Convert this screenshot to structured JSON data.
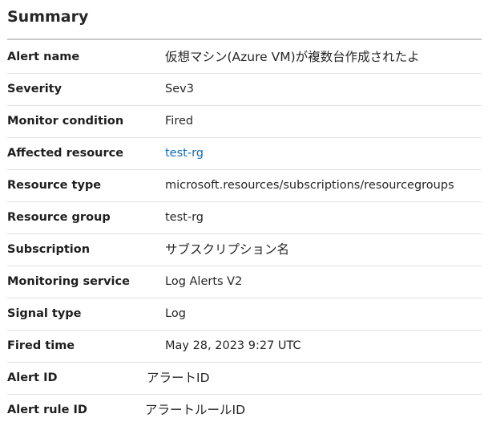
{
  "summary": {
    "title": "Summary",
    "rows": [
      {
        "label": "Alert name",
        "value": "仮想マシン(Azure VM)が複数台作成されたよ"
      },
      {
        "label": "Severity",
        "value": "Sev3"
      },
      {
        "label": "Monitor condition",
        "value": "Fired"
      },
      {
        "label": "Affected resource",
        "value": "test-rg"
      },
      {
        "label": "Resource type",
        "value": "microsoft.resources/subscriptions/resourcegroups"
      },
      {
        "label": "Resource group",
        "value": "test-rg"
      },
      {
        "label": "Subscription",
        "value": "サブスクリプション名"
      },
      {
        "label": "Monitoring service",
        "value": "Log Alerts V2"
      },
      {
        "label": "Signal type",
        "value": "Log"
      },
      {
        "label": "Fired time",
        "value": "May 28, 2023 9:27 UTC"
      },
      {
        "label": "Alert ID",
        "value": "アラートID"
      },
      {
        "label": "Alert rule ID",
        "value": "アラートルールID"
      }
    ],
    "link_color": "#0f6cbd"
  }
}
